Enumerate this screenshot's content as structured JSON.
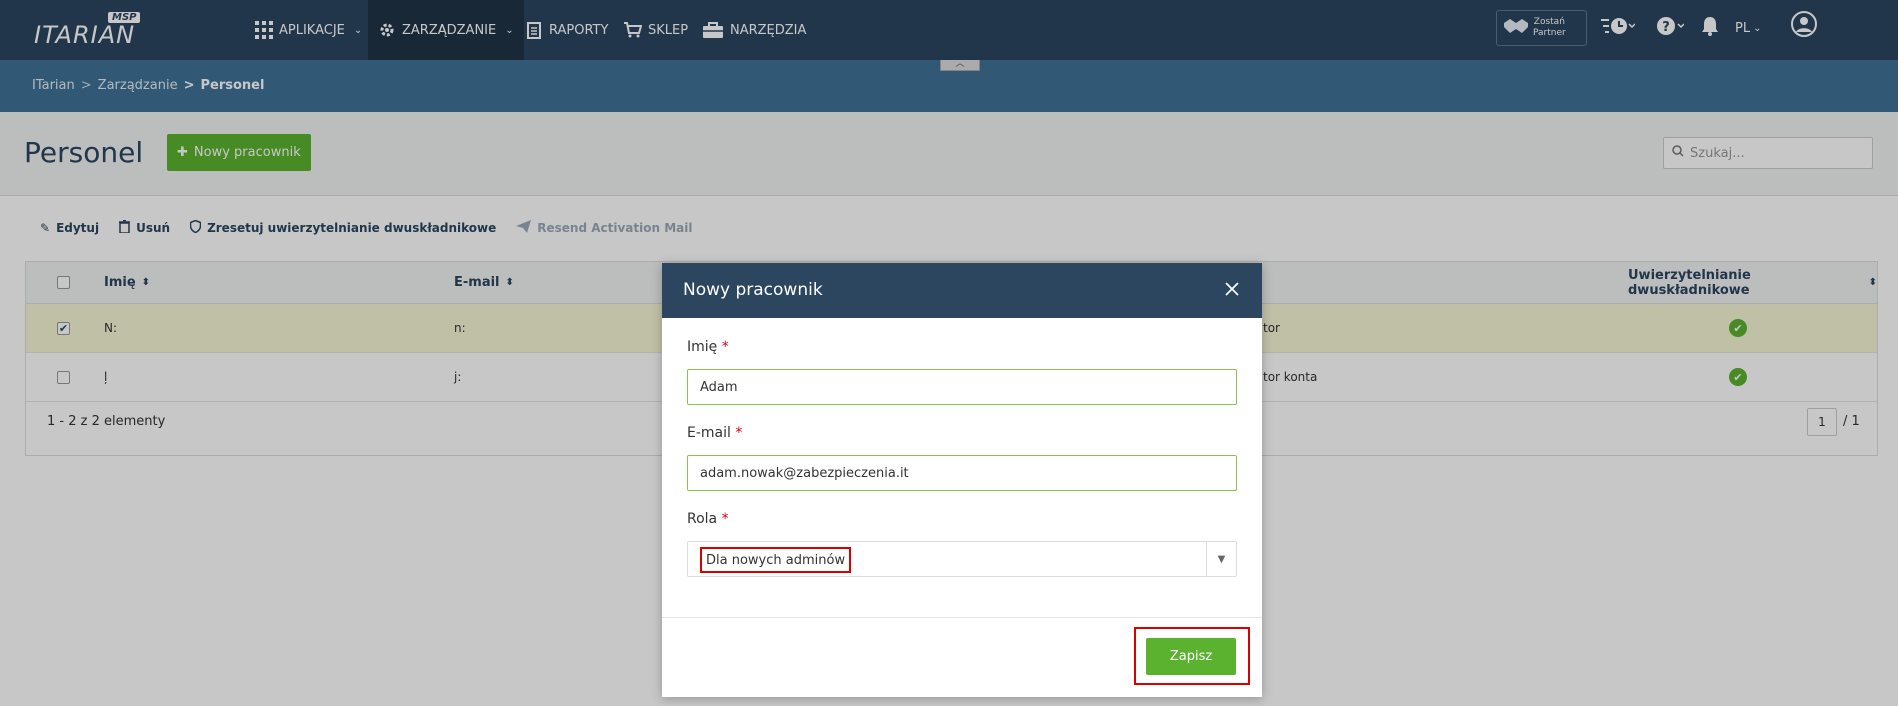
{
  "nav": {
    "logo_text": "ITARIAN",
    "logo_badge": "MSP",
    "items": [
      {
        "label": "APLIKACJE",
        "icon": "apps-grid-icon"
      },
      {
        "label": "ZARZĄDZANIE",
        "icon": "gear-icon"
      },
      {
        "label": "RAPORTY",
        "icon": "report-icon"
      },
      {
        "label": "SKLEP",
        "icon": "cart-icon"
      },
      {
        "label": "NARZĘDZIA",
        "icon": "toolbox-icon"
      }
    ],
    "partner_line1": "Zostań",
    "partner_line2": "Partner",
    "language": "PL"
  },
  "breadcrumb": {
    "items": [
      "ITarian",
      "Zarządzanie"
    ],
    "current": "Personel",
    "separator": ">"
  },
  "page": {
    "title": "Personel",
    "new_button": "Nowy pracownik",
    "search_placeholder": "Szukaj..."
  },
  "toolbar": {
    "edit": "Edytuj",
    "delete": "Usuń",
    "reset_2fa": "Zresetuj uwierzytelnianie dwuskładnikowe",
    "resend": "Resend Activation Mail"
  },
  "table": {
    "columns": {
      "name": "Imię",
      "email": "E-mail",
      "twofa": "Uwierzytelnianie dwuskładnikowe"
    },
    "rows": [
      {
        "name": "N:",
        "email": "n:",
        "role": "tor",
        "selected": true
      },
      {
        "name": "ļ",
        "email": "j:",
        "role": "tor konta",
        "selected": false
      }
    ],
    "footer": "1 - 2 z 2 elementy",
    "page": "1",
    "page_total": "/ 1"
  },
  "modal": {
    "title": "Nowy pracownik",
    "name_label": "Imię",
    "name_value": "Adam",
    "email_label": "E-mail",
    "email_value": "adam.nowak@zabezpieczenia.it",
    "role_label": "Rola",
    "role_value": "Dla nowych adminów",
    "required_mark": "*",
    "save": "Zapisz"
  },
  "colors": {
    "nav_bg": "#2c4660",
    "breadcrumb_bg": "#3f7397",
    "accent_green": "#5bb22f",
    "highlight_red": "#d80000"
  }
}
